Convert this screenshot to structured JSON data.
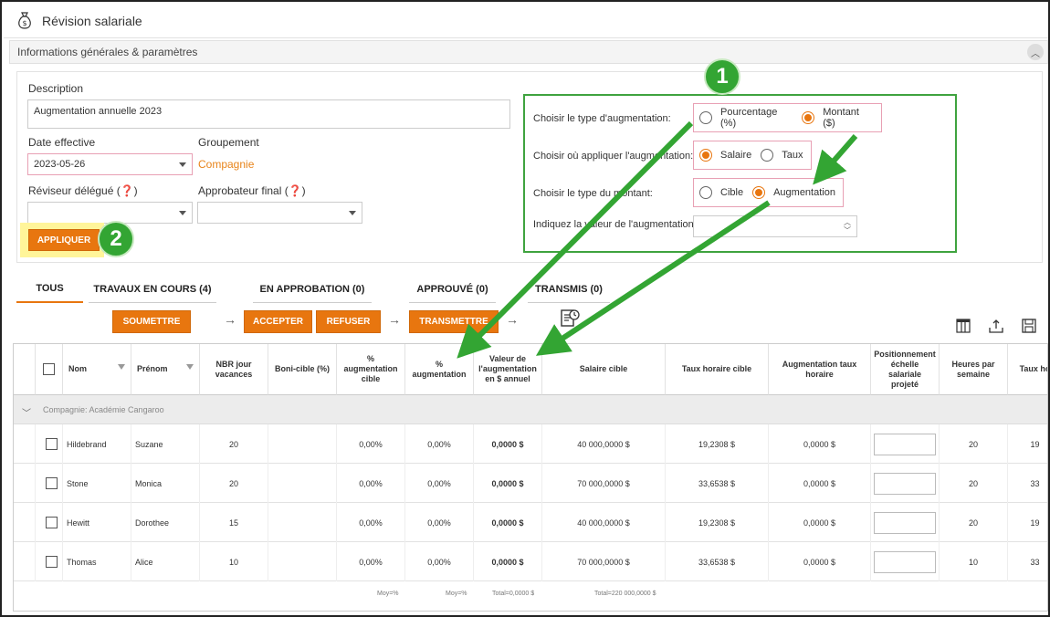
{
  "page": {
    "title": "Révision salariale"
  },
  "section": {
    "title": "Informations générales & paramètres"
  },
  "form": {
    "description_label": "Description",
    "description_value": "Augmentation annuelle 2023",
    "date_label": "Date effective",
    "date_value": "2023-05-26",
    "group_label": "Groupement",
    "group_value": "Compagnie",
    "reviewer_label": "Réviseur délégué (❓)",
    "approver_label": "Approbateur final (❓)",
    "apply_button": "APPLIQUER"
  },
  "callouts": {
    "one": "1",
    "two": "2"
  },
  "options": {
    "type_label": "Choisir le type d'augmentation:",
    "type_opt1": "Pourcentage (%)",
    "type_opt2": "Montant ($)",
    "apply_label": "Choisir où appliquer l'augmentation:",
    "apply_opt1": "Salaire",
    "apply_opt2": "Taux",
    "amount_label": "Choisir le type du montant:",
    "amount_opt1": "Cible",
    "amount_opt2": "Augmentation",
    "value_label": "Indiquez la valeur de l'augmentation:"
  },
  "tabs": [
    {
      "label": "TOUS"
    },
    {
      "label": "TRAVAUX EN COURS (4)"
    },
    {
      "label": "EN APPROBATION (0)"
    },
    {
      "label": "APPROUVÉ (0)"
    },
    {
      "label": "TRANSMIS (0)"
    }
  ],
  "actions": {
    "submit": "SOUMETTRE",
    "accept": "ACCEPTER",
    "refuse": "REFUSER",
    "transmit": "TRANSMETTRE"
  },
  "grid": {
    "headers": [
      "Nom",
      "Prénom",
      "NBR jour vacances",
      "Boni-cible (%)",
      "% augmentation cible",
      "% augmentation",
      "Valeur de l'augmentation en $ annuel",
      "Salaire cible",
      "Taux horaire cible",
      "Augmentation taux horaire",
      "Positionnement échelle salariale projeté",
      "Heures par semaine",
      "Taux ho"
    ],
    "group": "Compagnie: Académie Cangaroo",
    "rows": [
      {
        "nom": "Hildebrand",
        "prenom": "Suzane",
        "vacances": "20",
        "pct_cible": "0,00%",
        "pct": "0,00%",
        "valeur": "0,0000 $",
        "salaire": "40 000,0000 $",
        "taux": "19,2308 $",
        "aug_taux": "0,0000 $",
        "heures": "20",
        "taux_h": "19"
      },
      {
        "nom": "Stone",
        "prenom": "Monica",
        "vacances": "20",
        "pct_cible": "0,00%",
        "pct": "0,00%",
        "valeur": "0,0000 $",
        "salaire": "70 000,0000 $",
        "taux": "33,6538 $",
        "aug_taux": "0,0000 $",
        "heures": "20",
        "taux_h": "33"
      },
      {
        "nom": "Hewitt",
        "prenom": "Dorothee",
        "vacances": "15",
        "pct_cible": "0,00%",
        "pct": "0,00%",
        "valeur": "0,0000 $",
        "salaire": "40 000,0000 $",
        "taux": "19,2308 $",
        "aug_taux": "0,0000 $",
        "heures": "20",
        "taux_h": "19"
      },
      {
        "nom": "Thomas",
        "prenom": "Alice",
        "vacances": "10",
        "pct_cible": "0,00%",
        "pct": "0,00%",
        "valeur": "0,0000 $",
        "salaire": "70 000,0000 $",
        "taux": "33,6538 $",
        "aug_taux": "0,0000 $",
        "heures": "10",
        "taux_h": "33"
      }
    ],
    "footer": {
      "moy1": "Moy=%",
      "moy2": "Moy=%",
      "total1": "Total=0,0000 $",
      "total2": "Total=220 000,0000 $"
    }
  },
  "colors": {
    "accent": "#e8760f",
    "callout": "#33a533"
  }
}
